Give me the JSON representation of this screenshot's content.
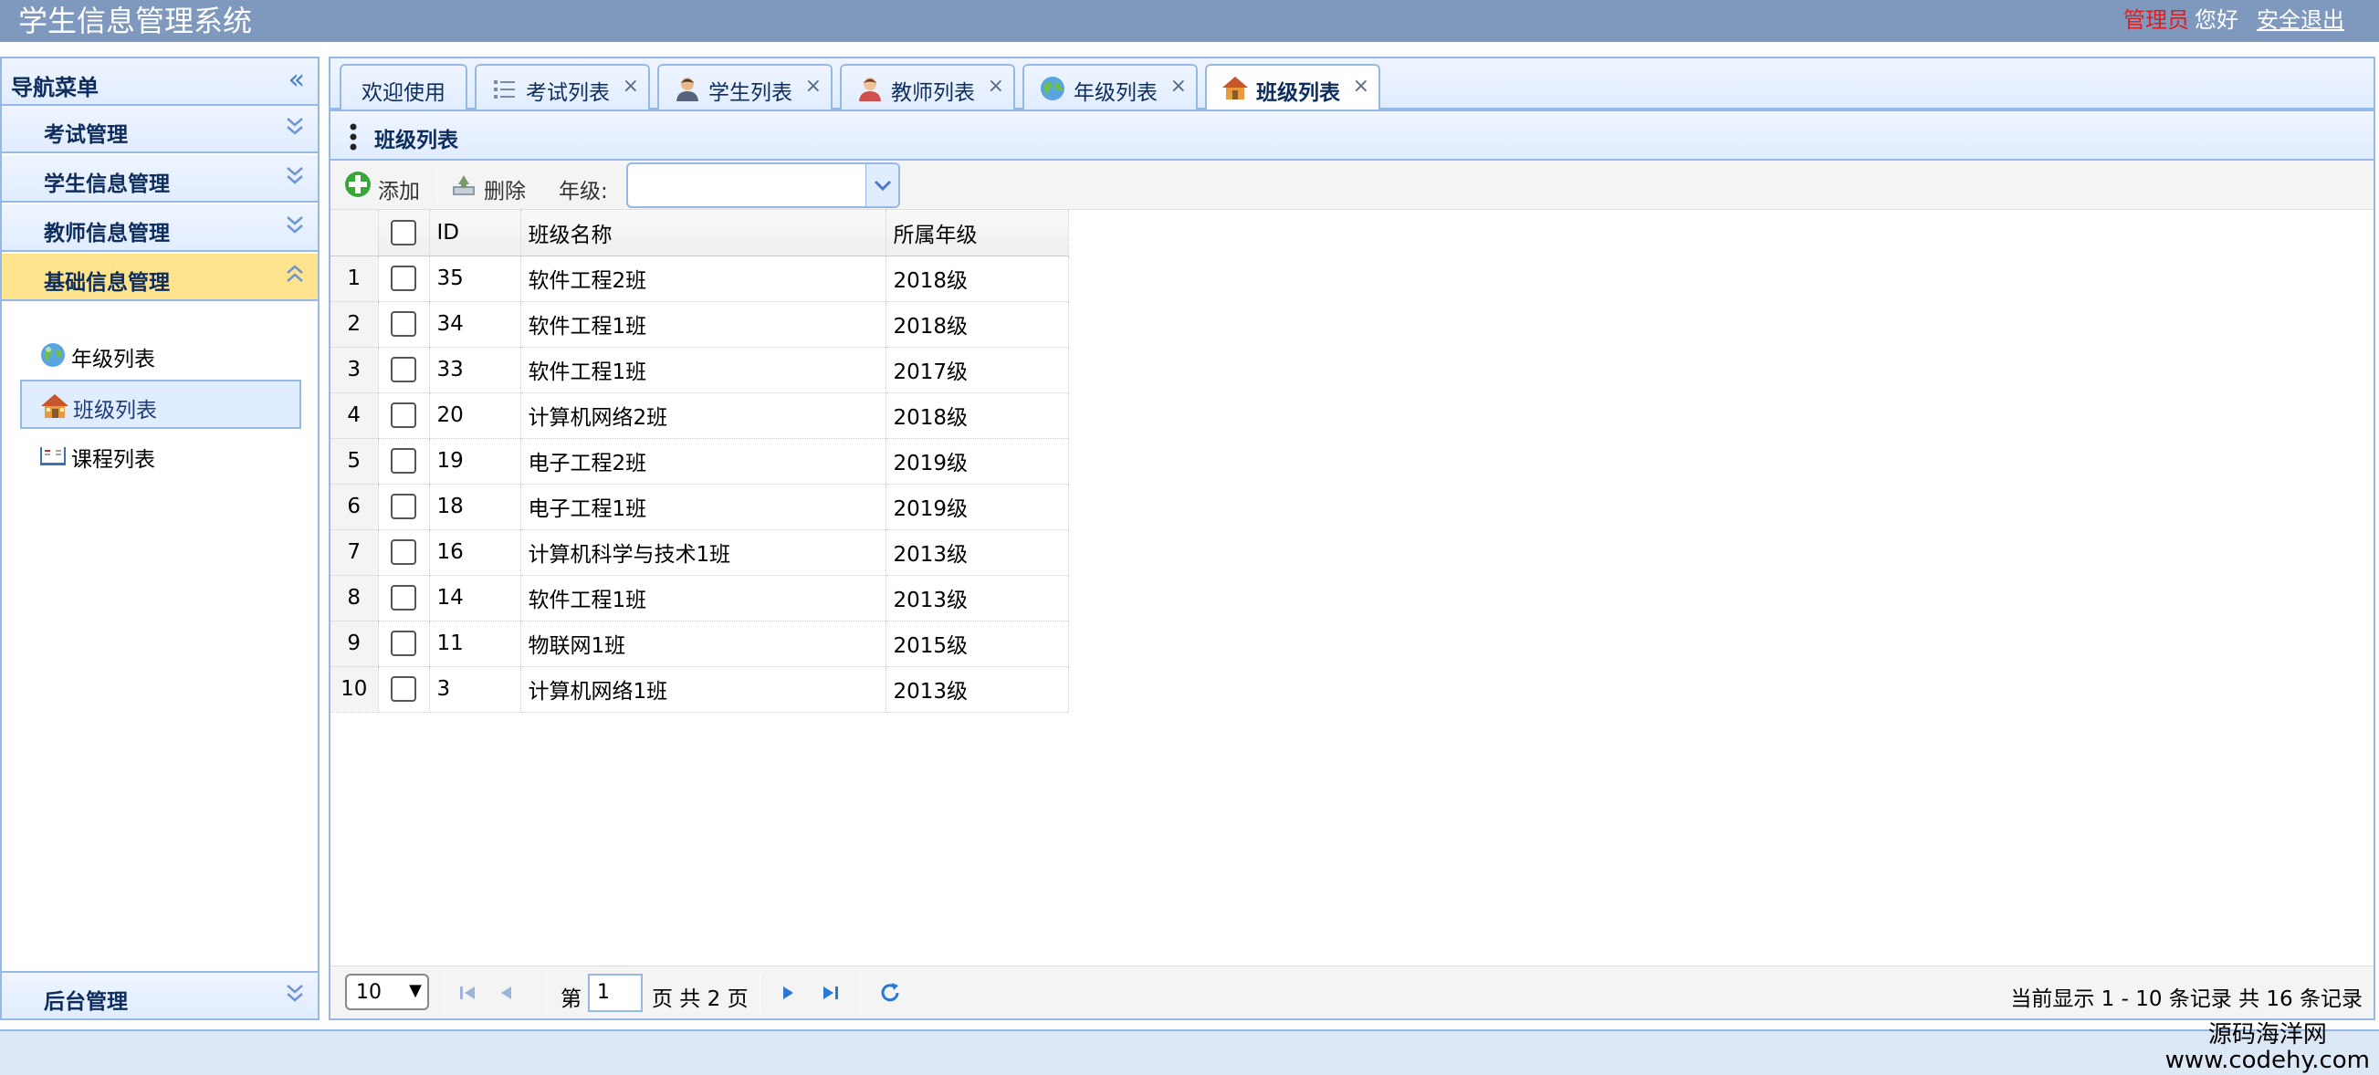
{
  "header": {
    "title": "学生信息管理系统",
    "user_role": "管理员",
    "greeting": "您好",
    "logout": "安全退出"
  },
  "nav": {
    "title": "导航菜单",
    "sections": [
      {
        "label": "考试管理",
        "expanded": false
      },
      {
        "label": "学生信息管理",
        "expanded": false
      },
      {
        "label": "教师信息管理",
        "expanded": false
      },
      {
        "label": "基础信息管理",
        "expanded": true
      },
      {
        "label": "后台管理",
        "expanded": false
      }
    ],
    "items": [
      {
        "label": "年级列表",
        "icon": "globe-icon",
        "selected": false
      },
      {
        "label": "班级列表",
        "icon": "house-icon",
        "selected": true
      },
      {
        "label": "课程列表",
        "icon": "book-icon",
        "selected": false
      }
    ]
  },
  "tabs": [
    {
      "label": "欢迎使用",
      "icon": null,
      "closable": false
    },
    {
      "label": "考试列表",
      "icon": "list-icon",
      "closable": true
    },
    {
      "label": "学生列表",
      "icon": "student-icon",
      "closable": true
    },
    {
      "label": "教师列表",
      "icon": "teacher-icon",
      "closable": true
    },
    {
      "label": "年级列表",
      "icon": "globe-icon",
      "closable": true
    },
    {
      "label": "班级列表",
      "icon": "house-icon",
      "closable": true,
      "active": true
    }
  ],
  "tab_close_glyph": "×",
  "grid": {
    "title": "班级列表",
    "toolbar": {
      "add_label": "添加",
      "delete_label": "删除",
      "grade_label": "年级:",
      "grade_value": ""
    },
    "columns": [
      "ID",
      "班级名称",
      "所属年级"
    ],
    "rows": [
      {
        "n": "1",
        "id": "35",
        "name": "软件工程2班",
        "grade": "2018级"
      },
      {
        "n": "2",
        "id": "34",
        "name": "软件工程1班",
        "grade": "2018级"
      },
      {
        "n": "3",
        "id": "33",
        "name": "软件工程1班",
        "grade": "2017级"
      },
      {
        "n": "4",
        "id": "20",
        "name": "计算机网络2班",
        "grade": "2018级"
      },
      {
        "n": "5",
        "id": "19",
        "name": "电子工程2班",
        "grade": "2019级"
      },
      {
        "n": "6",
        "id": "18",
        "name": "电子工程1班",
        "grade": "2019级"
      },
      {
        "n": "7",
        "id": "16",
        "name": "计算机科学与技术1班",
        "grade": "2013级"
      },
      {
        "n": "8",
        "id": "14",
        "name": "软件工程1班",
        "grade": "2013级"
      },
      {
        "n": "9",
        "id": "11",
        "name": "物联网1班",
        "grade": "2015级"
      },
      {
        "n": "10",
        "id": "3",
        "name": "计算机网络1班",
        "grade": "2013级"
      }
    ]
  },
  "pager": {
    "page_size": "10",
    "prefix": "第",
    "current_page": "1",
    "suffix": "页 共 2 页",
    "info": "当前显示 1 - 10 条记录 共 16 条记录"
  },
  "watermark": {
    "line1": "源码海洋网",
    "line2": "www.codehy.com"
  },
  "colors": {
    "header_bg": "#7f99be",
    "panel_border": "#95b8e7",
    "active_section": "#ffe48d",
    "role_text": "#e01c1c"
  }
}
